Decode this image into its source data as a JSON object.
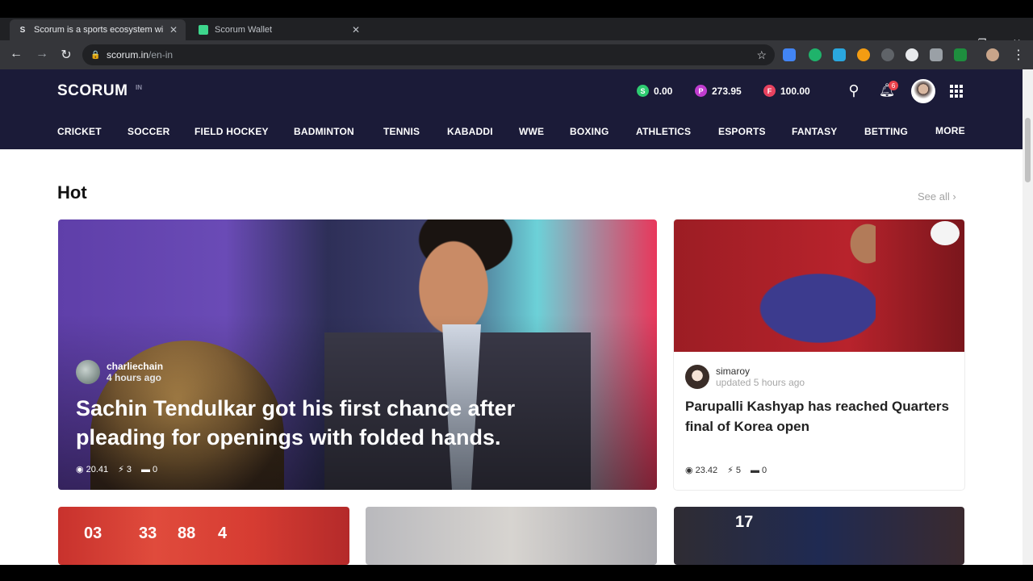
{
  "browser": {
    "tabs": [
      {
        "title": "Scorum is a sports ecosystem wi",
        "active": true,
        "favicon": "S"
      },
      {
        "title": "Scorum Wallet",
        "active": false,
        "favicon": "wallet-icon"
      }
    ],
    "url": {
      "host": "scorum.in",
      "path": "/en-in"
    }
  },
  "site": {
    "logo": "SCORUM",
    "region": "IN",
    "wallet": [
      {
        "symbol": "S",
        "value": "0.00",
        "color": "#2ecc71"
      },
      {
        "symbol": "P",
        "value": "273.95",
        "color": "#c03ccf"
      },
      {
        "symbol": "F",
        "value": "100.00",
        "color": "#e8425f"
      }
    ],
    "notification_count": "6",
    "nav": [
      "CRICKET",
      "SOCCER",
      "FIELD HOCKEY",
      "BADMINTON",
      "TENNIS",
      "KABADDI",
      "WWE",
      "BOXING",
      "ATHLETICS",
      "ESPORTS",
      "FANTASY",
      "BETTING",
      "MORE"
    ]
  },
  "hot": {
    "title": "Hot",
    "see_all": "See all ›",
    "hero": {
      "author": "charliechain",
      "time": "4 hours ago",
      "title": "Sachin Tendulkar got his first chance after pleading for openings with folded hands.",
      "stats": {
        "coins": "20.41",
        "votes": "3",
        "comments": "0"
      }
    },
    "card": {
      "author": "simaroy",
      "time": "updated 5 hours ago",
      "title": "Parupalli Kashyap has reached Quarters final of Korea open",
      "stats": {
        "coins": "23.42",
        "votes": "5",
        "comments": "0"
      }
    },
    "thumbs": [
      "03",
      "33",
      "88",
      "4",
      "17"
    ]
  }
}
